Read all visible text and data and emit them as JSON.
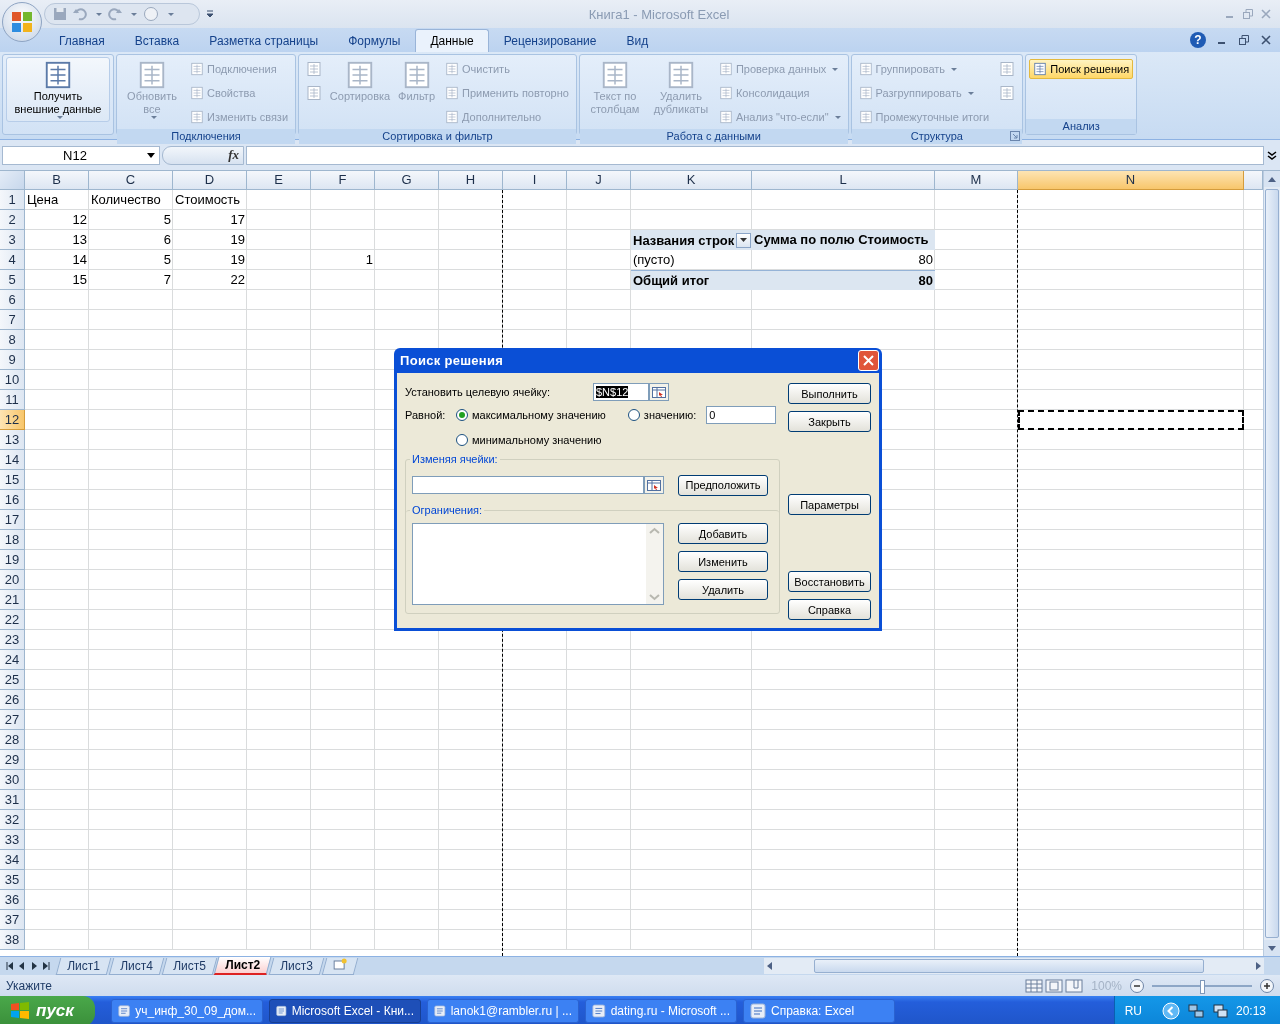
{
  "window": {
    "title": "Книга1 - Microsoft Excel"
  },
  "tabs": [
    {
      "label": "Главная",
      "selected": false
    },
    {
      "label": "Вставка",
      "selected": false
    },
    {
      "label": "Разметка страницы",
      "selected": false
    },
    {
      "label": "Формулы",
      "selected": false
    },
    {
      "label": "Данные",
      "selected": true
    },
    {
      "label": "Рецензирование",
      "selected": false
    },
    {
      "label": "Вид",
      "selected": false
    }
  ],
  "help": "?",
  "ribbon": {
    "groups": [
      {
        "items": [
          {
            "kind": "large",
            "label": "Получить внешние данные",
            "disabled": false,
            "menu": true
          }
        ]
      },
      {
        "label": "Подключения",
        "items": [
          {
            "kind": "large",
            "label": "Обновить все",
            "disabled": true,
            "menu": true
          },
          {
            "kind": "small",
            "label": "Подключения",
            "disabled": true,
            "menu": false
          },
          {
            "kind": "small",
            "label": "Свойства",
            "disabled": true,
            "menu": false
          },
          {
            "kind": "small",
            "label": "Изменить связи",
            "disabled": true,
            "menu": false
          }
        ]
      },
      {
        "label": "Сортировка и фильтр",
        "items": [
          {
            "kind": "icon",
            "disabled": true
          },
          {
            "kind": "icon",
            "disabled": true
          },
          {
            "kind": "large",
            "label": "Сортировка",
            "disabled": true,
            "menu": false
          },
          {
            "kind": "large",
            "label": "Фильтр",
            "disabled": true,
            "menu": false
          },
          {
            "kind": "small",
            "label": "Очистить",
            "disabled": true,
            "menu": false
          },
          {
            "kind": "small",
            "label": "Применить повторно",
            "disabled": true,
            "menu": false
          },
          {
            "kind": "small",
            "label": "Дополнительно",
            "disabled": true,
            "menu": false
          }
        ]
      },
      {
        "label": "Работа с данными",
        "items": [
          {
            "kind": "large",
            "label": "Текст по столбцам",
            "disabled": true,
            "menu": false
          },
          {
            "kind": "large",
            "label": "Удалить дубликаты",
            "disabled": true,
            "menu": false
          },
          {
            "kind": "small",
            "label": "Проверка данных",
            "disabled": true,
            "menu": true
          },
          {
            "kind": "small",
            "label": "Консолидация",
            "disabled": true,
            "menu": false
          },
          {
            "kind": "small",
            "label": "Анализ \"что-если\"",
            "disabled": true,
            "menu": true
          }
        ]
      },
      {
        "label": "Структура",
        "launcher": true,
        "items": [
          {
            "kind": "small",
            "label": "Группировать",
            "disabled": true,
            "menu": true
          },
          {
            "kind": "small",
            "label": "Разгруппировать",
            "disabled": true,
            "menu": true
          },
          {
            "kind": "small",
            "label": "Промежуточные итоги",
            "disabled": true,
            "menu": false
          },
          {
            "kind": "icon",
            "disabled": true
          },
          {
            "kind": "icon",
            "disabled": true
          }
        ]
      },
      {
        "label": "Анализ",
        "items": [
          {
            "kind": "small",
            "label": "Поиск решения",
            "disabled": false,
            "menu": false,
            "highlighted": true
          }
        ]
      }
    ]
  },
  "formula_bar": {
    "name_box": "N12",
    "function_button": "fx"
  },
  "sheet": {
    "columns": [
      {
        "label": "B",
        "selected": false,
        "page_break": false
      },
      {
        "label": "C",
        "selected": false,
        "page_break": false
      },
      {
        "label": "D",
        "selected": false,
        "page_break": false
      },
      {
        "label": "E",
        "selected": false,
        "page_break": false
      },
      {
        "label": "F",
        "selected": false,
        "page_break": false
      },
      {
        "label": "G",
        "selected": false,
        "page_break": false
      },
      {
        "label": "H",
        "selected": false,
        "page_break": true
      },
      {
        "label": "I",
        "selected": false,
        "page_break": false
      },
      {
        "label": "J",
        "selected": false,
        "page_break": false
      },
      {
        "label": "K",
        "selected": false,
        "page_break": false
      },
      {
        "label": "L",
        "selected": false,
        "page_break": false
      },
      {
        "label": "M",
        "selected": false,
        "page_break": true
      },
      {
        "label": "N",
        "selected": true,
        "page_break": false
      }
    ],
    "rows": [
      {
        "number": "1",
        "selected": false,
        "cells": {
          "B": {
            "kind": "text",
            "text": "Цена"
          },
          "C": {
            "kind": "text",
            "text": "Количество"
          },
          "D": {
            "kind": "text",
            "text": "Стоимость"
          }
        }
      },
      {
        "number": "2",
        "selected": false,
        "cells": {
          "B": {
            "kind": "number",
            "text": "12"
          },
          "C": {
            "kind": "number",
            "text": "5"
          },
          "D": {
            "kind": "number",
            "text": "17"
          }
        }
      },
      {
        "number": "3",
        "selected": false,
        "cells": {
          "B": {
            "kind": "number",
            "text": "13"
          },
          "C": {
            "kind": "number",
            "text": "6"
          },
          "D": {
            "kind": "number",
            "text": "19"
          },
          "K": {
            "kind": "pivot-header",
            "text": "Названия строк",
            "filter": true
          },
          "L": {
            "kind": "pivot-header",
            "text": "Сумма по полю Стоимость"
          }
        }
      },
      {
        "number": "4",
        "selected": false,
        "cells": {
          "B": {
            "kind": "number",
            "text": "14"
          },
          "C": {
            "kind": "number",
            "text": "5"
          },
          "D": {
            "kind": "number",
            "text": "19"
          },
          "F": {
            "kind": "number",
            "text": "1"
          },
          "K": {
            "kind": "text",
            "text": "(пусто)"
          },
          "L": {
            "kind": "number",
            "text": "80"
          }
        }
      },
      {
        "number": "5",
        "selected": false,
        "cells": {
          "B": {
            "kind": "number",
            "text": "15"
          },
          "C": {
            "kind": "number",
            "text": "7"
          },
          "D": {
            "kind": "number",
            "text": "22"
          },
          "K": {
            "kind": "pivot-total",
            "text": "Общий итог"
          },
          "L": {
            "kind": "pivot-total-number",
            "text": "80"
          }
        }
      },
      {
        "number": "6",
        "selected": false
      },
      {
        "number": "7",
        "selected": false
      },
      {
        "number": "8",
        "selected": false
      },
      {
        "number": "9",
        "selected": false
      },
      {
        "number": "10",
        "selected": false
      },
      {
        "number": "11",
        "selected": false
      },
      {
        "number": "12",
        "selected": true
      },
      {
        "number": "13",
        "selected": false
      },
      {
        "number": "14",
        "selected": false
      },
      {
        "number": "15",
        "selected": false
      },
      {
        "number": "16",
        "selected": false
      },
      {
        "number": "17",
        "selected": false
      },
      {
        "number": "18",
        "selected": false
      },
      {
        "number": "19",
        "selected": false
      },
      {
        "number": "20",
        "selected": false
      },
      {
        "number": "21",
        "selected": false
      },
      {
        "number": "22",
        "selected": false
      },
      {
        "number": "23",
        "selected": false
      },
      {
        "number": "24",
        "selected": false
      },
      {
        "number": "25",
        "selected": false
      },
      {
        "number": "26",
        "selected": false
      },
      {
        "number": "27",
        "selected": false
      },
      {
        "number": "28",
        "selected": false
      },
      {
        "number": "29",
        "selected": false
      },
      {
        "number": "30",
        "selected": false
      },
      {
        "number": "31",
        "selected": false
      },
      {
        "number": "32",
        "selected": false
      },
      {
        "number": "33",
        "selected": false
      },
      {
        "number": "34",
        "selected": false
      },
      {
        "number": "35",
        "selected": false
      },
      {
        "number": "36",
        "selected": false
      },
      {
        "number": "37",
        "selected": false
      },
      {
        "number": "38",
        "selected": false
      }
    ]
  },
  "sheet_tabs": [
    {
      "label": "Лист1",
      "selected": false
    },
    {
      "label": "Лист4",
      "selected": false
    },
    {
      "label": "Лист5",
      "selected": false
    },
    {
      "label": "Лист2",
      "selected": true
    },
    {
      "label": "Лист3",
      "selected": false
    }
  ],
  "status_bar": {
    "mode": "Укажите",
    "zoom": {
      "text": "100%",
      "level": 0.5
    }
  },
  "dialog": {
    "title": "Поиск решения",
    "target_label": "Установить целевую ячейку:",
    "target_value": "$N$12",
    "equal_label": "Равной:",
    "options": [
      {
        "label": "максимальному значению",
        "selected": true
      },
      {
        "label": "значению:",
        "selected": false
      },
      {
        "label": "минимальному значению",
        "selected": false
      }
    ],
    "value_field": "0",
    "changing_label": "Изменяя ячейки:",
    "guess_button": "Предположить",
    "constraints_label": "Ограничения:",
    "constraint_buttons": [
      "Добавить",
      "Изменить",
      "Удалить"
    ],
    "side_buttons": [
      "Выполнить",
      "Закрыть",
      "Параметры",
      "Восстановить",
      "Справка"
    ]
  },
  "taskbar": {
    "start": "пуск",
    "tasks": [
      {
        "label": "уч_инф_30_09_дом...",
        "selected": false
      },
      {
        "label": "Microsoft Excel - Кни...",
        "selected": true
      },
      {
        "label": "lanok1@rambler.ru | ...",
        "selected": false
      },
      {
        "label": "dating.ru - Microsoft ...",
        "selected": false
      },
      {
        "label": "Справка: Excel",
        "selected": false
      }
    ],
    "language": "RU",
    "clock": "20:13"
  }
}
